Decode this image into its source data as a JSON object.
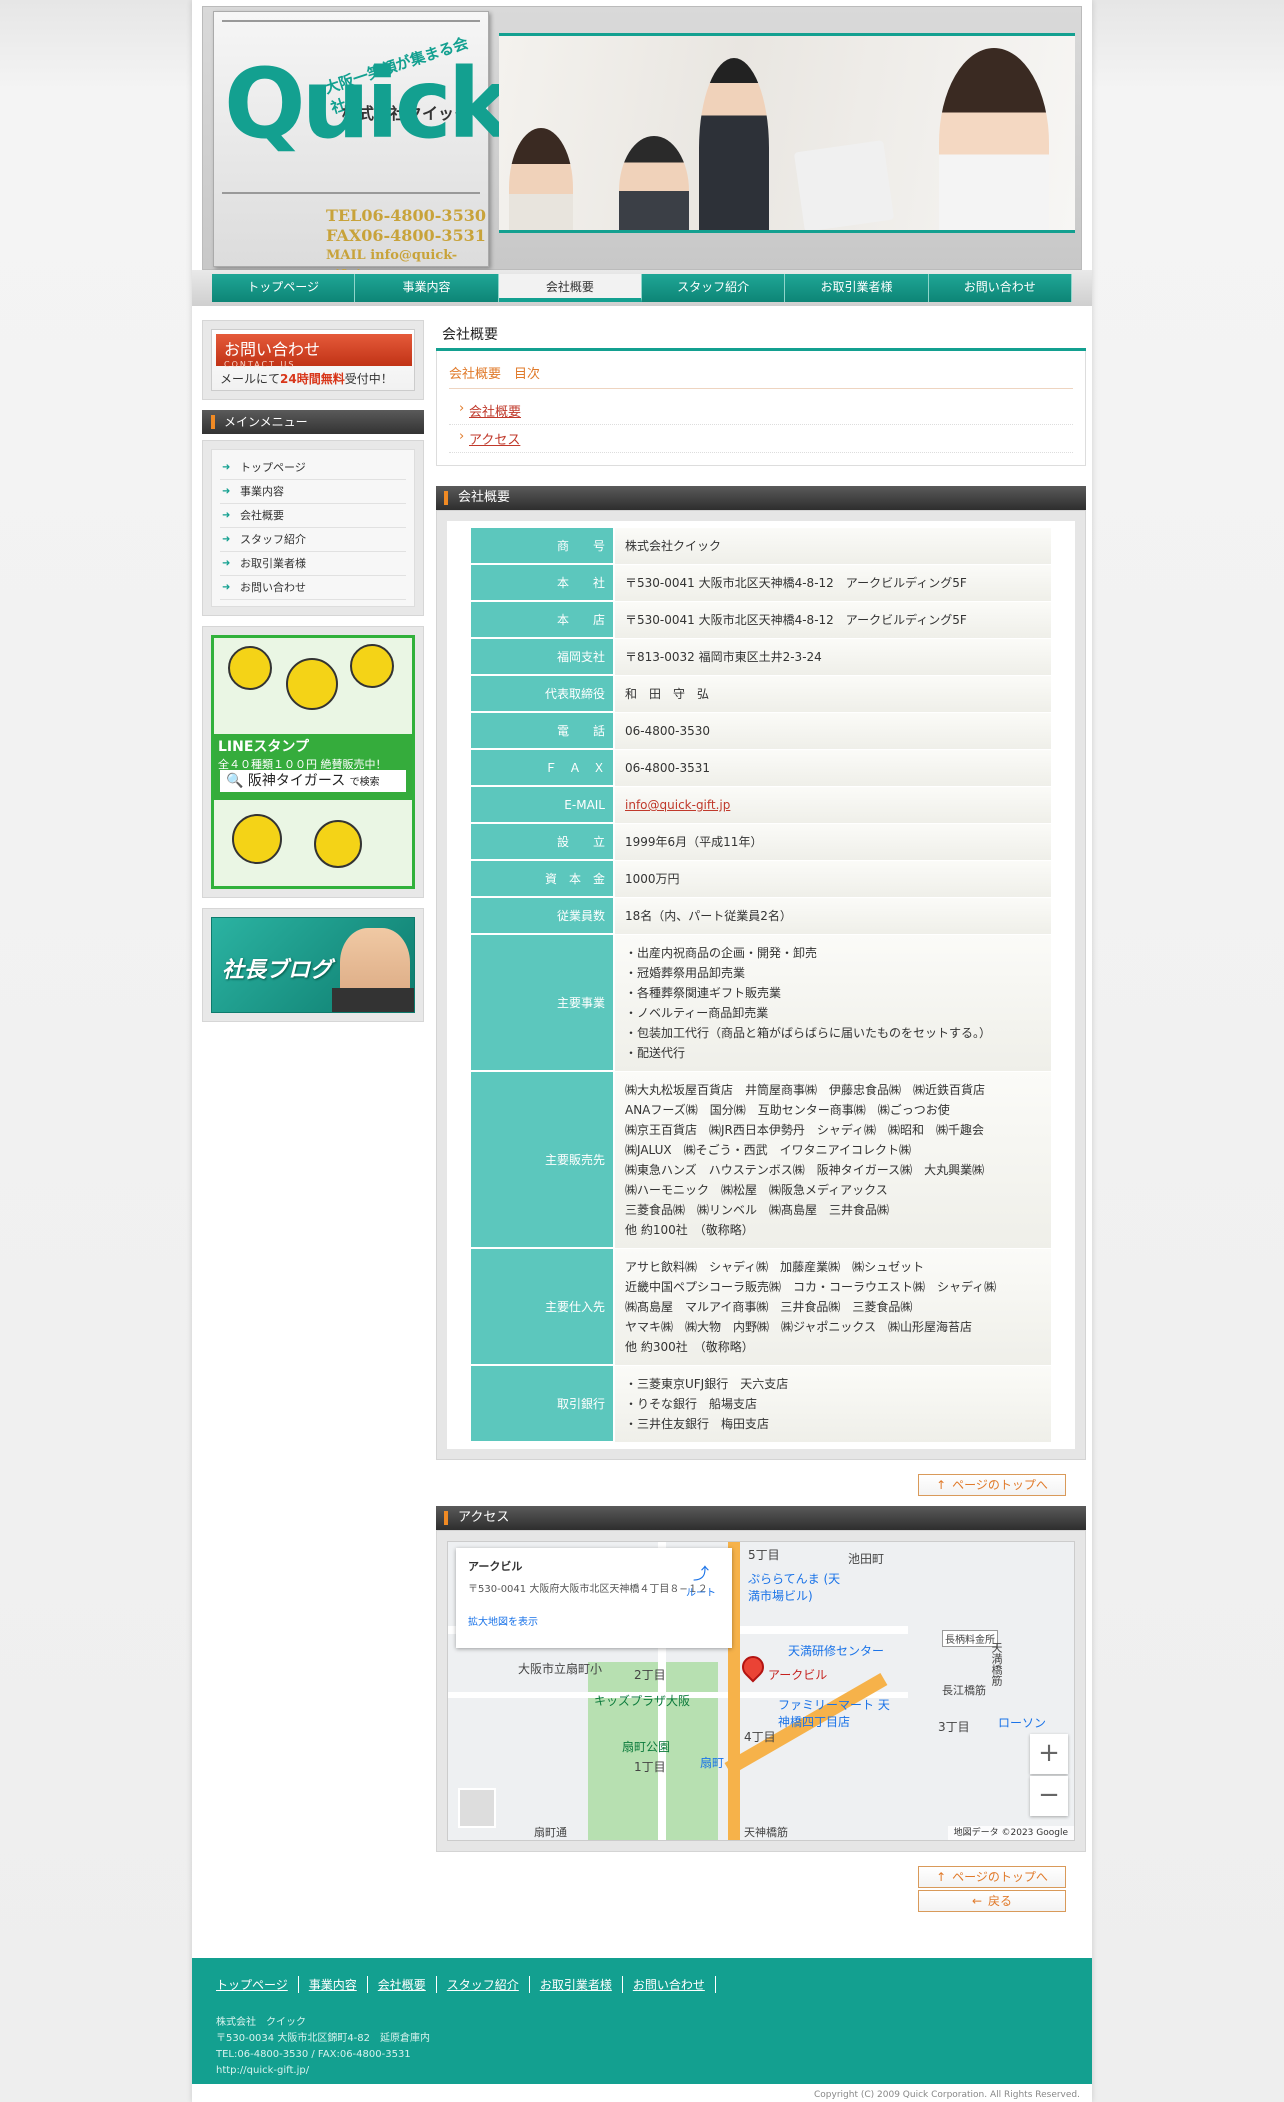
{
  "header": {
    "tagline": "大阪一笑顔が集まる会社",
    "company_small": "株式会社クイック",
    "logo_text": "Quick",
    "tel": "TEL06-4800-3530",
    "fax": "FAX06-4800-3531",
    "mail": "MAIL info@quick-gift.jp"
  },
  "nav": [
    {
      "label": "トップページ"
    },
    {
      "label": "事業内容"
    },
    {
      "label": "会社概要",
      "active": true
    },
    {
      "label": "スタッフ紹介"
    },
    {
      "label": "お取引業者様"
    },
    {
      "label": "お問い合わせ"
    }
  ],
  "sidebar": {
    "contact_banner": {
      "title": "お問い合わせ",
      "en": "CONTACT US",
      "sub_pre": "メールにて",
      "sub_em": "24時間無料",
      "sub_post": "受付中！"
    },
    "menu_heading": "メインメニュー",
    "menu": [
      "トップページ",
      "事業内容",
      "会社概要",
      "スタッフ紹介",
      "お取引業者様",
      "お問い合わせ"
    ],
    "line_banner": {
      "title": "LINEスタンプ",
      "sub": "全４０種類１００円 絶賛販売中！",
      "search": "阪神タイガース",
      "search_suffix": "で検索"
    },
    "blog_banner": "社長ブログ"
  },
  "main": {
    "page_title": "会社概要",
    "toc_title": "会社概要　目次",
    "toc": [
      "会社概要",
      "アクセス"
    ],
    "section1_title": "会社概要",
    "rows": [
      {
        "label": "商　　号",
        "value": "株式会社クイック"
      },
      {
        "label": "本　　社",
        "value": "〒530-0041 大阪市北区天神橋4-8-12　アークビルディング5F"
      },
      {
        "label": "本　　店",
        "value": "〒530-0041 大阪市北区天神橋4-8-12　アークビルディング5F"
      },
      {
        "label": "福岡支社",
        "value": "〒813-0032 福岡市東区土井2-3-24"
      },
      {
        "label": "代表取締役",
        "value": "和　田　守　弘"
      },
      {
        "label": "電　　話",
        "value": "06-4800-3530"
      },
      {
        "label": "Ｆ　Ａ　Ｘ",
        "value": "06-4800-3531"
      },
      {
        "label": "E-MAIL",
        "value": "info@quick-gift.jp",
        "link": true
      },
      {
        "label": "設　　立",
        "value": "1999年6月（平成11年）"
      },
      {
        "label": "資　本　金",
        "value": "1000万円"
      },
      {
        "label": "従業員数",
        "value": "18名（内、パート従業員2名）"
      },
      {
        "label": "主要事業",
        "value": "・出産内祝商品の企画・開発・卸売\n・冠婚葬祭用品卸売業\n・各種葬祭関連ギフト販売業\n・ノベルティー商品卸売業\n・包装加工代行（商品と箱がばらばらに届いたものをセットする。）\n・配送代行"
      },
      {
        "label": "主要販売先",
        "value": "㈱大丸松坂屋百貨店　井筒屋商事㈱　伊藤忠食品㈱　㈱近鉄百貨店\nANAフーズ㈱　国分㈱　互助センター商事㈱　㈱ごっつお使\n㈱京王百貨店　㈱JR西日本伊勢丹　シャディ㈱　㈱昭和　㈱千趣会\n㈱JALUX　㈱そごう・西武　イワタニアイコレクト㈱\n㈱東急ハンズ　ハウステンボス㈱　阪神タイガース㈱　大丸興業㈱\n㈱ハーモニック　㈱松屋　㈱阪急メディアックス\n三菱食品㈱　㈱リンベル　㈱髙島屋　三井食品㈱\n他 約100社　（敬称略）"
      },
      {
        "label": "主要仕入先",
        "value": "アサヒ飲料㈱　シャディ㈱　加藤産業㈱　㈱シュゼット\n近畿中国ペプシコーラ販売㈱　コカ・コーラウエスト㈱　シャディ㈱\n㈱髙島屋　マルアイ商事㈱　三井食品㈱　三菱食品㈱\nヤマキ㈱　㈱大物　内野㈱　㈱ジャポニックス　㈱山形屋海苔店\n他 約300社　（敬称略）"
      },
      {
        "label": "取引銀行",
        "value": "・三菱東京UFJ銀行　天六支店\n・りそな銀行　船場支店\n・三井住友銀行　梅田支店"
      }
    ],
    "to_top": "ページのトップへ",
    "section2_title": "アクセス",
    "map": {
      "info_name": "アークビル",
      "info_addr": "〒530-0041 大阪府大阪市北区天神橋４丁目８−１２",
      "info_link": "拡大地図を表示",
      "directions": "ルート",
      "labels": [
        "5丁目",
        "池田町",
        "ぷららてんま (天満市場ビル)",
        "天満研修センター",
        "長柄料金所",
        "アークビル",
        "大阪市立扇町小",
        "2丁目",
        "キッズプラザ大阪",
        "長江橋筋",
        "ファミリーマート 天神橋四丁目店",
        "3丁目",
        "ローソン",
        "扇町公園",
        "4丁目",
        "1丁目",
        "扇町",
        "天神橋筋",
        "扇町通",
        "天満橋筋"
      ],
      "footer": "地図データ ©2023 Google"
    },
    "back": "戻る"
  },
  "footer": {
    "links": [
      "トップページ",
      "事業内容",
      "会社概要",
      "スタッフ紹介",
      "お取引業者様",
      "お問い合わせ"
    ],
    "company": "株式会社　クイック",
    "address": "〒530-0034 大阪市北区錦町4-82　延原倉庫内",
    "telfax": "TEL:06-4800-3530 / FAX:06-4800-3531",
    "url": "http://quick-gift.jp/",
    "copyright": "Copyright (C) 2009 Quick Corporation. All Rights Reserved."
  }
}
